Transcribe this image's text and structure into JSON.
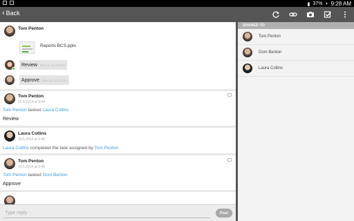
{
  "statusbar": {
    "battery": "37%",
    "time": "9:28 AM"
  },
  "actionbar": {
    "back_label": "Back",
    "icons": [
      "refresh-icon",
      "link-icon",
      "camera-icon",
      "checkbox-icon",
      "overflow-menu-icon"
    ]
  },
  "feed": {
    "post1": {
      "author": "Tom Penton",
      "file_name": "Reports BCS.pptx",
      "tasks": [
        {
          "label": "Review",
          "date": "Due on 21.5.2014"
        },
        {
          "label": "Approve",
          "date": "Due on 21.5.2014"
        }
      ]
    },
    "post2": {
      "author": "Tom Penton",
      "date": "16.5.2014 at 9:44",
      "actor": "Tom Penton",
      "verb": "tasked",
      "target": "Laura Collins",
      "text": "Review"
    },
    "post3": {
      "author": "Laura Collins",
      "date": "16.5.2014 at 9:46",
      "actor": "Laura Collins",
      "verb": "completed the task assigned by",
      "target": "Tom Penton"
    },
    "post4": {
      "author": "Tom Penton",
      "date": "16.5.2014 at 9:45",
      "actor": "Tom Penton",
      "verb": "tasked",
      "target": "Dom Benton",
      "text": "Approve"
    }
  },
  "reply": {
    "placeholder": "Type reply",
    "post_label": "Post"
  },
  "shared": {
    "header": "SHARED TO",
    "people": [
      {
        "name": "Tom Penton"
      },
      {
        "name": "Dom Benton"
      },
      {
        "name": "Laura Collins"
      }
    ]
  }
}
